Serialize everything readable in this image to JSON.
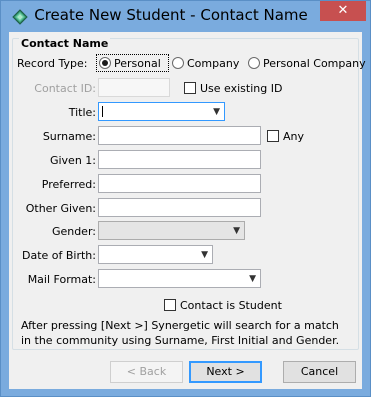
{
  "window": {
    "title": "Create New Student - Contact Name",
    "close_glyph": "✕"
  },
  "group": {
    "title": "Contact Name"
  },
  "record_type": {
    "label": "Record Type:",
    "options": [
      "Personal",
      "Company",
      "Personal Company"
    ],
    "selected": "Personal"
  },
  "contact_id": {
    "label": "Contact ID:",
    "value": "",
    "use_existing_label": "Use existing ID",
    "use_existing_checked": false
  },
  "fields": {
    "title_label": "Title:",
    "title_value": "",
    "surname_label": "Surname:",
    "surname_value": "",
    "any_label": "Any",
    "any_checked": false,
    "given1_label": "Given 1:",
    "given1_value": "",
    "preferred_label": "Preferred:",
    "preferred_value": "",
    "other_given_label": "Other Given:",
    "other_given_value": "",
    "gender_label": "Gender:",
    "gender_value": "",
    "dob_label": "Date of Birth:",
    "dob_value": "",
    "mail_format_label": "Mail Format:",
    "mail_format_value": ""
  },
  "contact_is_student": {
    "label": "Contact is Student",
    "checked": false
  },
  "info_text": "After pressing [Next >] Synergetic will search for a match in the community using Surname, First Initial and Gender.",
  "buttons": {
    "back": "< Back",
    "next": "Next >",
    "cancel": "Cancel"
  },
  "icons": {
    "app": "synergetic-diamond-icon",
    "dropdown": "chevron-down-icon"
  },
  "colors": {
    "titlebar": "#7aabde",
    "close": "#c75050",
    "dialog_bg": "#f0f0f0",
    "focus": "#3399ff"
  }
}
